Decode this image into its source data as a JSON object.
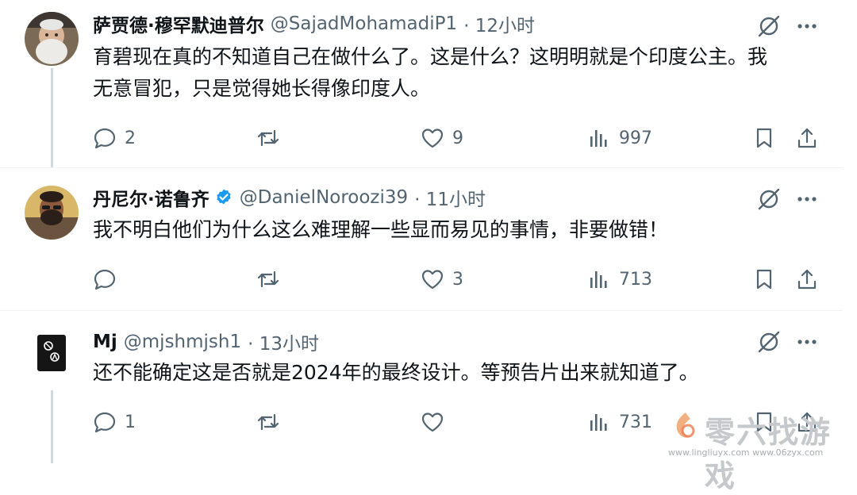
{
  "tweets": [
    {
      "name": "萨贾德·穆罕默迪普尔",
      "handle": "@SajadMohamadiP1",
      "time": "· 12小时",
      "text_line1": "育碧现在真的不知道自己在做什么了。这是什么？这明明就是个印度公主。我",
      "text_line2": "无意冒犯，只是觉得她长得像印度人。",
      "replies": "2",
      "retweets": "",
      "likes": "9",
      "views": "997",
      "verified": false
    },
    {
      "name": "丹尼尔·诺鲁齐",
      "handle": "@DanielNoroozi39",
      "time": "· 11小时",
      "text_line1": "我不明白他们为什么这么难理解一些显而易见的事情，非要做错！",
      "replies": "",
      "retweets": "",
      "likes": "3",
      "views": "713",
      "verified": true
    },
    {
      "name": "Mj",
      "handle": "@mjshmjsh1",
      "time": "· 13小时",
      "text_line1": "还不能确定这是否就是2024年的最终设计。等预告片出来就知道了。",
      "replies": "1",
      "retweets": "",
      "likes": "",
      "views": "731",
      "verified": false
    }
  ],
  "icons": {
    "reply": "reply-icon",
    "retweet": "retweet-icon",
    "like": "like-icon",
    "views": "views-icon",
    "bookmark": "bookmark-icon",
    "share": "share-icon",
    "grok": "grok-icon",
    "more": "more-icon",
    "verified": "verified-badge-icon"
  },
  "colors": {
    "text": "#0f1419",
    "secondary": "#536471",
    "verified": "#1d9bf0",
    "thread_line": "#cfd9de",
    "separator": "#eff3f4"
  },
  "watermark": {
    "title": "零六找游戏",
    "urls": "www.lingliuyx.com   www.06zyx.com"
  }
}
